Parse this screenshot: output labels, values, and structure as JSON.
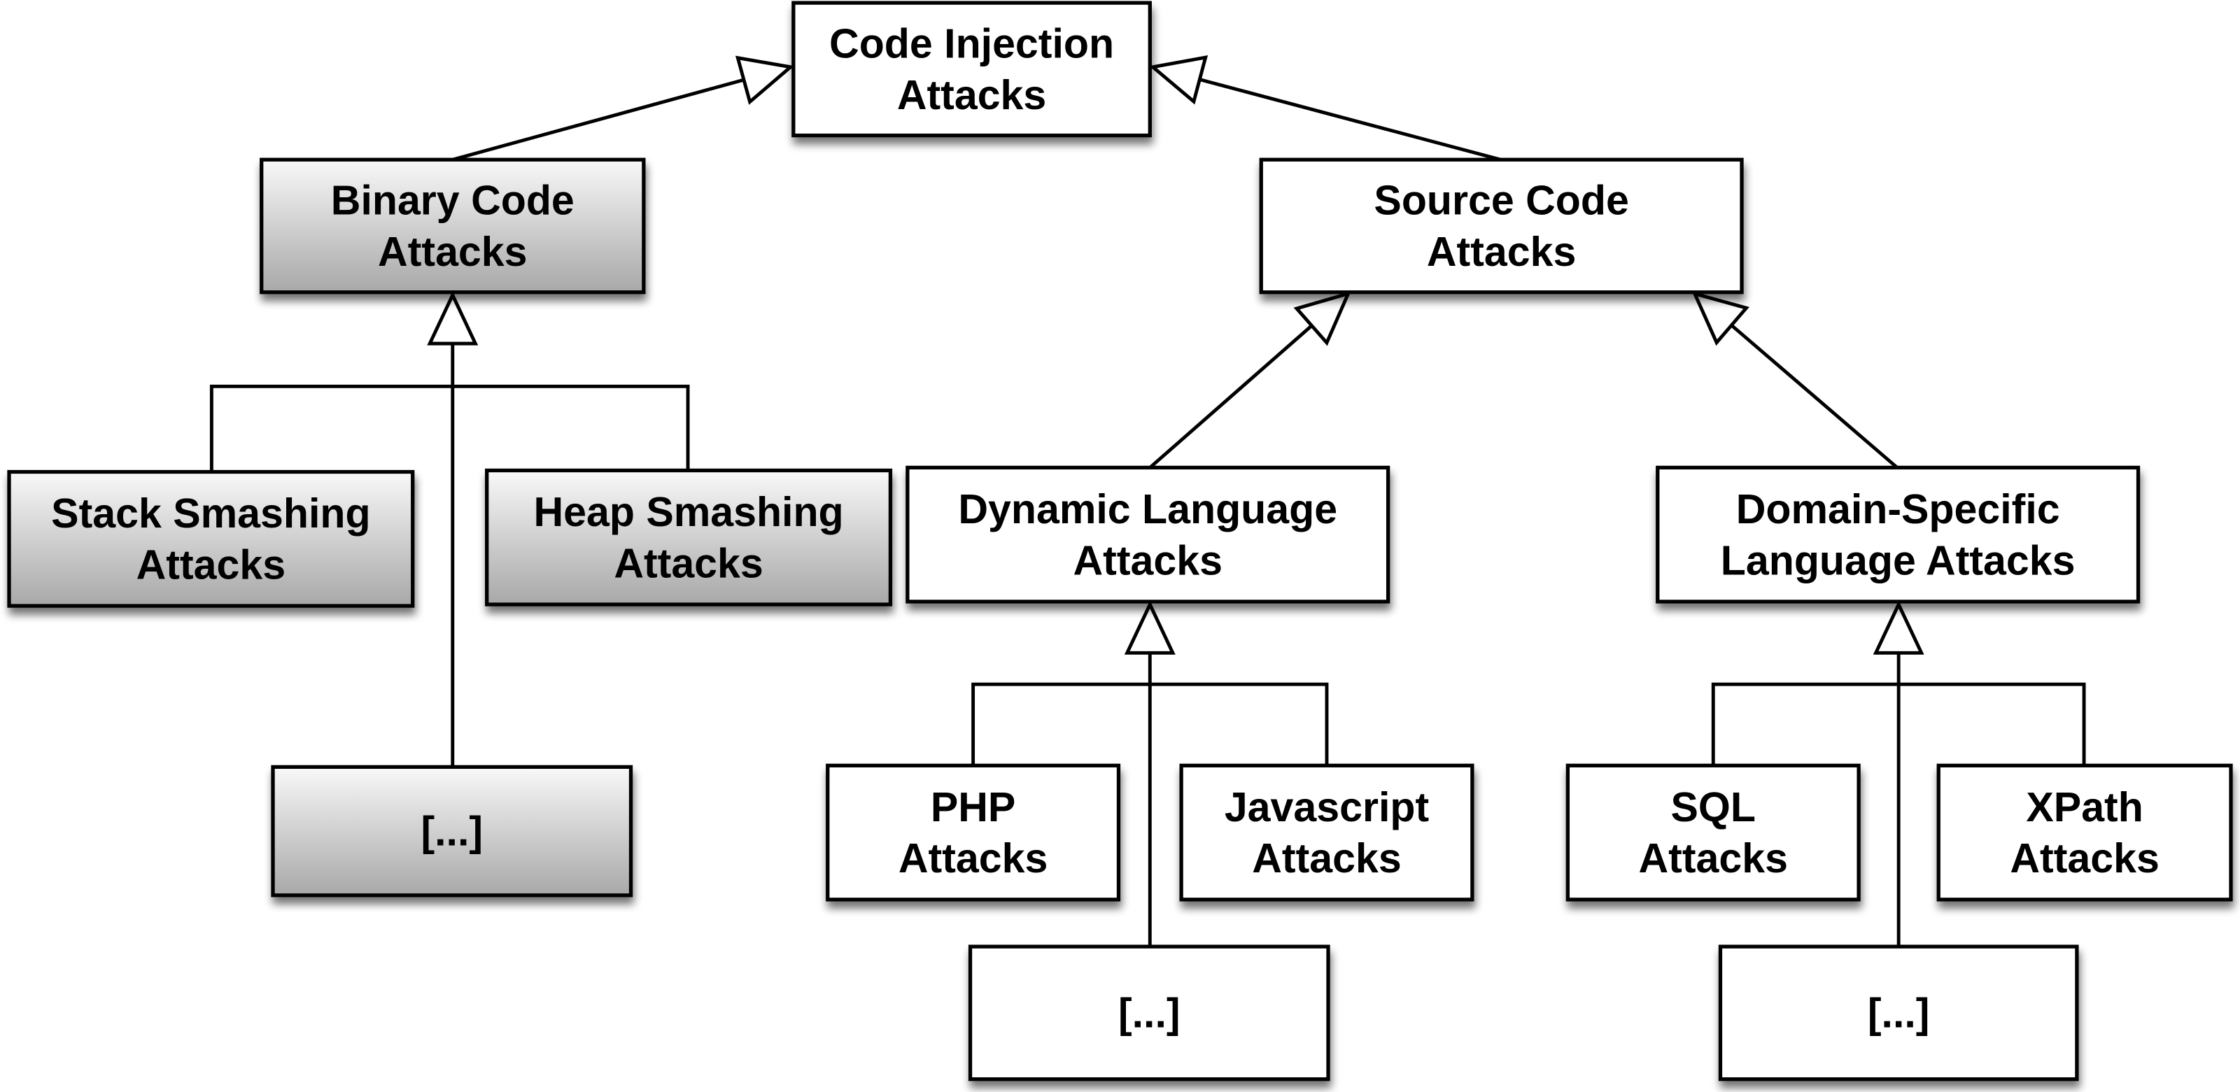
{
  "diagram": {
    "type": "inheritance-hierarchy",
    "nodes": [
      {
        "id": "code-injection",
        "lines": [
          "Code Injection",
          "Attacks"
        ],
        "style": "white"
      },
      {
        "id": "binary-code",
        "lines": [
          "Binary Code",
          "Attacks"
        ],
        "style": "gray"
      },
      {
        "id": "source-code",
        "lines": [
          "Source Code",
          "Attacks"
        ],
        "style": "white"
      },
      {
        "id": "stack-smashing",
        "lines": [
          "Stack Smashing",
          "Attacks"
        ],
        "style": "gray"
      },
      {
        "id": "heap-smashing",
        "lines": [
          "Heap Smashing",
          "Attacks"
        ],
        "style": "gray"
      },
      {
        "id": "binary-more",
        "lines": [
          "[...]"
        ],
        "style": "gray"
      },
      {
        "id": "dynamic-language",
        "lines": [
          "Dynamic Language",
          "Attacks"
        ],
        "style": "white"
      },
      {
        "id": "domain-specific",
        "lines": [
          "Domain-Specific",
          "Language Attacks"
        ],
        "style": "white"
      },
      {
        "id": "php",
        "lines": [
          "PHP",
          "Attacks"
        ],
        "style": "white"
      },
      {
        "id": "javascript",
        "lines": [
          "Javascript",
          "Attacks"
        ],
        "style": "white"
      },
      {
        "id": "dynamic-more",
        "lines": [
          "[...]"
        ],
        "style": "white"
      },
      {
        "id": "sql",
        "lines": [
          "SQL",
          "Attacks"
        ],
        "style": "white"
      },
      {
        "id": "xpath",
        "lines": [
          "XPath",
          "Attacks"
        ],
        "style": "white"
      },
      {
        "id": "dsl-more",
        "lines": [
          "[...]"
        ],
        "style": "white"
      }
    ],
    "edges": [
      {
        "from": "binary-code",
        "to": "code-injection",
        "kind": "generalization"
      },
      {
        "from": "source-code",
        "to": "code-injection",
        "kind": "generalization"
      },
      {
        "from": "stack-smashing",
        "to": "binary-code",
        "kind": "generalization"
      },
      {
        "from": "heap-smashing",
        "to": "binary-code",
        "kind": "generalization"
      },
      {
        "from": "binary-more",
        "to": "binary-code",
        "kind": "generalization"
      },
      {
        "from": "dynamic-language",
        "to": "source-code",
        "kind": "generalization"
      },
      {
        "from": "domain-specific",
        "to": "source-code",
        "kind": "generalization"
      },
      {
        "from": "php",
        "to": "dynamic-language",
        "kind": "generalization"
      },
      {
        "from": "javascript",
        "to": "dynamic-language",
        "kind": "generalization"
      },
      {
        "from": "dynamic-more",
        "to": "dynamic-language",
        "kind": "generalization"
      },
      {
        "from": "sql",
        "to": "domain-specific",
        "kind": "generalization"
      },
      {
        "from": "xpath",
        "to": "domain-specific",
        "kind": "generalization"
      },
      {
        "from": "dsl-more",
        "to": "domain-specific",
        "kind": "generalization"
      }
    ],
    "colors": {
      "stroke": "#000000",
      "white_fill": "#ffffff",
      "gray_fill_top": "#f8f8f8",
      "gray_fill_bottom": "#a8a8a8",
      "shadow": "#808080"
    }
  }
}
